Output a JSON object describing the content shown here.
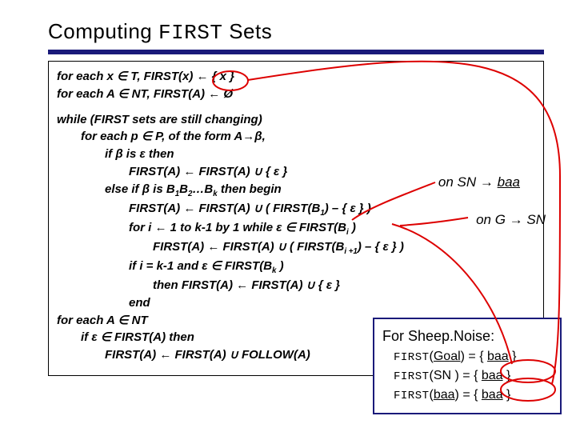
{
  "title_a": "Computing ",
  "title_b": "FIRST",
  "title_c": " Sets",
  "algo": {
    "l1a": "for each x ",
    "l1b": "∈",
    "l1c": " T, FIRST(x) ",
    "l1d": "←",
    "l1e": " { x }",
    "l2a": "for each A ",
    "l2b": "∈",
    "l2c": " NT, FIRST(A) ",
    "l2d": "←",
    "l2e": " Ø",
    "l3": "while (FIRST sets are still changing)",
    "l4a": "for each p ",
    "l4b": "∈",
    "l4c": " P, of the form A",
    "l4d": "→",
    "l4e": "β,",
    "l5a": "if β is ",
    "l5b": "ε",
    "l5c": " then",
    "l6a": "FIRST(A) ",
    "l6b": "←",
    "l6c": " FIRST(A) ",
    "l6d": "∪",
    "l6e": " { ",
    "l6f": "ε",
    "l6g": " }",
    "l7a": "else if β is B",
    "l7s1": "1",
    "l7b": "B",
    "l7s2": "2",
    "l7c": "…B",
    "l7s3": "k",
    "l7d": " then begin",
    "l8a": "FIRST(A) ",
    "l8b": "←",
    "l8c": " FIRST(A) ",
    "l8d": "∪",
    "l8e": " ( FIRST(B",
    "l8s": "1",
    "l8f": ") – { ",
    "l8g": "ε",
    "l8h": " } )",
    "l9a": "for i ",
    "l9b": "←",
    "l9c": " 1 to k-1 by 1 while ",
    "l9d": "ε",
    "l9e": " ",
    "l9f": "∈",
    "l9g": " FIRST(B",
    "l9s": "i",
    "l9h": " )",
    "l10a": "FIRST(A) ",
    "l10b": "←",
    "l10c": " FIRST(A) ",
    "l10d": "∪",
    "l10e": " ( FIRST(B",
    "l10s": "i +1",
    "l10f": ") – { ",
    "l10g": "ε",
    "l10h": " } )",
    "l11a": "if i = k-1 and ",
    "l11b": "ε",
    "l11c": " ",
    "l11d": "∈",
    "l11e": " FIRST(B",
    "l11s": "k",
    "l11f": " )",
    "l12a": "then FIRST(A) ",
    "l12b": "←",
    "l12c": " FIRST(A) ",
    "l12d": "∪",
    "l12e": " { ",
    "l12f": "ε",
    "l12g": " }",
    "l13": "end",
    "l14a": "for each A ",
    "l14b": "∈",
    "l14c": " NT",
    "l15a": "if ",
    "l15b": "ε",
    "l15c": " ",
    "l15d": "∈",
    "l15e": " FIRST(A) then",
    "l16a": "FIRST(A) ",
    "l16b": "←",
    "l16c": " FIRST(A) ",
    "l16d": "∪",
    "l16e": " FOLLOW(A)"
  },
  "ann1a": "on SN ",
  "ann1b": "→",
  "ann1c": " ",
  "ann1d": "baa",
  "ann2a": "on G ",
  "ann2b": "→",
  "ann2c": " SN",
  "res": {
    "hdr": "For Sheep.Noise:",
    "r1a": "FIRST",
    "r1b": "(",
    "r1c": "Goal",
    "r1d": ") = { ",
    "r1e": "baa",
    "r1f": " }",
    "r2a": "FIRST",
    "r2b": "(SN ) = { ",
    "r2c": "baa",
    "r2d": " }",
    "r3a": "FIRST",
    "r3b": "(",
    "r3c": "baa",
    "r3d": ")  = { ",
    "r3e": "baa",
    "r3f": " }"
  }
}
